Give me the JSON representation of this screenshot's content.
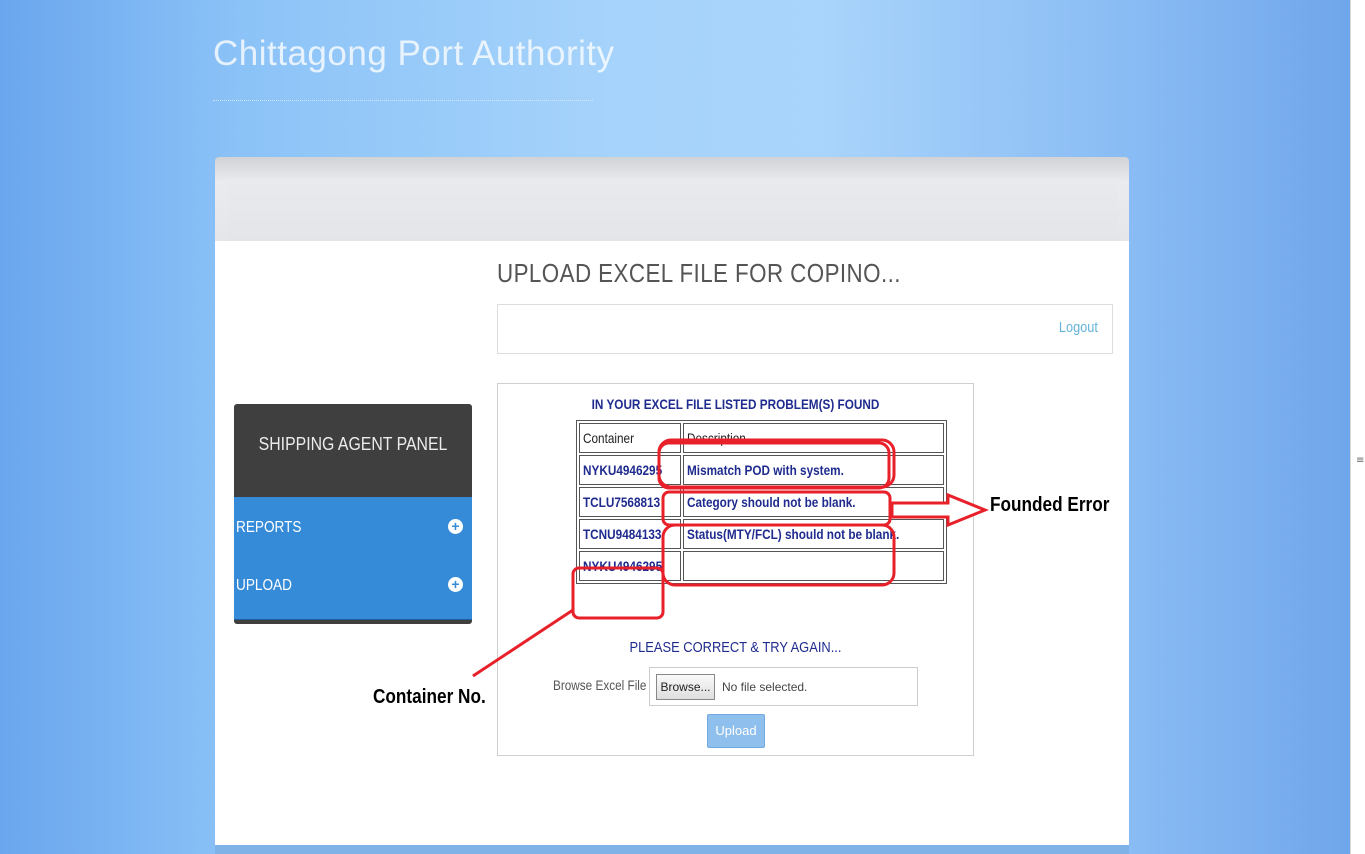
{
  "site": {
    "title": "Chittagong Port Authority"
  },
  "page": {
    "heading": "UPLOAD EXCEL FILE FOR COPINO...",
    "logout_label": "Logout"
  },
  "sidebar": {
    "title": "SHIPPING AGENT PANEL",
    "items": [
      {
        "label": "REPORTS"
      },
      {
        "label": "UPLOAD"
      }
    ]
  },
  "errors": {
    "heading": "IN YOUR EXCEL FILE LISTED PROBLEM(S) FOUND",
    "columns": [
      "Container",
      "Description"
    ],
    "rows": [
      {
        "container": "NYKU4946295",
        "description": "Mismatch POD with system."
      },
      {
        "container": "TCLU7568813",
        "description": "Category should not be blank."
      },
      {
        "container": "TCNU9484133",
        "description": "Status(MTY/FCL) should not be blank."
      },
      {
        "container": "NYKU4946295",
        "description": ""
      }
    ]
  },
  "upload": {
    "retry_message": "PLEASE CORRECT & TRY AGAIN...",
    "browse_label": "Browse Excel File",
    "browse_button": "Browse...",
    "no_file_text": "No file selected.",
    "upload_button": "Upload"
  },
  "annotations": {
    "founded_error": "Founded Error",
    "container_no": "Container No."
  },
  "colors": {
    "accent": "#368bd8",
    "error_text": "#1f2b8e",
    "annotation": "#e8202a"
  },
  "icons": {
    "expand": "plus-circle-icon"
  }
}
